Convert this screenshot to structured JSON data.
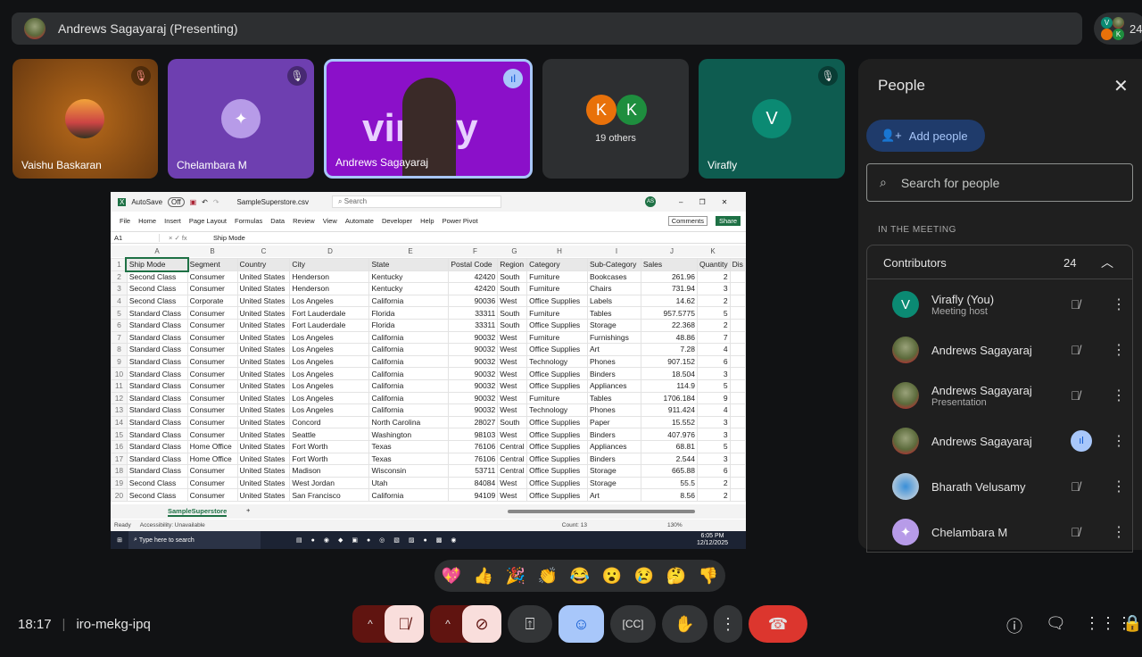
{
  "header": {
    "presenter": "Andrews Sagayaraj (Presenting)",
    "participant_count": "24",
    "mini_avatars": [
      "V",
      "K"
    ]
  },
  "tiles": [
    {
      "name": "Vaishu Baskaran",
      "color": "#8a4a10"
    },
    {
      "name": "Chelambara M",
      "color": "#6e3fb0"
    },
    {
      "name": "Andrews Sagayaraj",
      "color": "#8b10c9",
      "bg_text": "virafly"
    },
    {
      "name": "19 others",
      "avatars": [
        "K",
        "K"
      ],
      "color": "#2d2f31"
    },
    {
      "name": "Virafly",
      "initial": "V",
      "color": "#0e5c50"
    }
  ],
  "excel": {
    "autosave": "AutoSave",
    "autosave_state": "Off",
    "filename": "SampleSuperstore.csv",
    "search": "Search",
    "user": "AS",
    "menu": [
      "File",
      "Home",
      "Insert",
      "Page Layout",
      "Formulas",
      "Data",
      "Review",
      "View",
      "Automate",
      "Developer",
      "Help",
      "Power Pivot"
    ],
    "comments": "Comments",
    "share": "Share",
    "cell_ref": "A1",
    "formula": "Ship Mode",
    "col_letters": [
      "A",
      "B",
      "C",
      "D",
      "E",
      "F",
      "G",
      "H",
      "I",
      "J",
      "K",
      ""
    ],
    "headers": [
      "Ship Mode",
      "Segment",
      "Country",
      "City",
      "State",
      "Postal Code",
      "Region",
      "Category",
      "Sub-Category",
      "Sales",
      "Quantity",
      "Dis"
    ],
    "rows": [
      [
        "Second Class",
        "Consumer",
        "United States",
        "Henderson",
        "Kentucky",
        "42420",
        "South",
        "Furniture",
        "Bookcases",
        "261.96",
        "2"
      ],
      [
        "Second Class",
        "Consumer",
        "United States",
        "Henderson",
        "Kentucky",
        "42420",
        "South",
        "Furniture",
        "Chairs",
        "731.94",
        "3"
      ],
      [
        "Second Class",
        "Corporate",
        "United States",
        "Los Angeles",
        "California",
        "90036",
        "West",
        "Office Supplies",
        "Labels",
        "14.62",
        "2"
      ],
      [
        "Standard Class",
        "Consumer",
        "United States",
        "Fort Lauderdale",
        "Florida",
        "33311",
        "South",
        "Furniture",
        "Tables",
        "957.5775",
        "5"
      ],
      [
        "Standard Class",
        "Consumer",
        "United States",
        "Fort Lauderdale",
        "Florida",
        "33311",
        "South",
        "Office Supplies",
        "Storage",
        "22.368",
        "2"
      ],
      [
        "Standard Class",
        "Consumer",
        "United States",
        "Los Angeles",
        "California",
        "90032",
        "West",
        "Furniture",
        "Furnishings",
        "48.86",
        "7"
      ],
      [
        "Standard Class",
        "Consumer",
        "United States",
        "Los Angeles",
        "California",
        "90032",
        "West",
        "Office Supplies",
        "Art",
        "7.28",
        "4"
      ],
      [
        "Standard Class",
        "Consumer",
        "United States",
        "Los Angeles",
        "California",
        "90032",
        "West",
        "Technology",
        "Phones",
        "907.152",
        "6"
      ],
      [
        "Standard Class",
        "Consumer",
        "United States",
        "Los Angeles",
        "California",
        "90032",
        "West",
        "Office Supplies",
        "Binders",
        "18.504",
        "3"
      ],
      [
        "Standard Class",
        "Consumer",
        "United States",
        "Los Angeles",
        "California",
        "90032",
        "West",
        "Office Supplies",
        "Appliances",
        "114.9",
        "5"
      ],
      [
        "Standard Class",
        "Consumer",
        "United States",
        "Los Angeles",
        "California",
        "90032",
        "West",
        "Furniture",
        "Tables",
        "1706.184",
        "9"
      ],
      [
        "Standard Class",
        "Consumer",
        "United States",
        "Los Angeles",
        "California",
        "90032",
        "West",
        "Technology",
        "Phones",
        "911.424",
        "4"
      ],
      [
        "Standard Class",
        "Consumer",
        "United States",
        "Concord",
        "North Carolina",
        "28027",
        "South",
        "Office Supplies",
        "Paper",
        "15.552",
        "3"
      ],
      [
        "Standard Class",
        "Consumer",
        "United States",
        "Seattle",
        "Washington",
        "98103",
        "West",
        "Office Supplies",
        "Binders",
        "407.976",
        "3"
      ],
      [
        "Standard Class",
        "Home Office",
        "United States",
        "Fort Worth",
        "Texas",
        "76106",
        "Central",
        "Office Supplies",
        "Appliances",
        "68.81",
        "5"
      ],
      [
        "Standard Class",
        "Home Office",
        "United States",
        "Fort Worth",
        "Texas",
        "76106",
        "Central",
        "Office Supplies",
        "Binders",
        "2.544",
        "3"
      ],
      [
        "Standard Class",
        "Consumer",
        "United States",
        "Madison",
        "Wisconsin",
        "53711",
        "Central",
        "Office Supplies",
        "Storage",
        "665.88",
        "6"
      ],
      [
        "Second Class",
        "Consumer",
        "United States",
        "West Jordan",
        "Utah",
        "84084",
        "West",
        "Office Supplies",
        "Storage",
        "55.5",
        "2"
      ],
      [
        "Second Class",
        "Consumer",
        "United States",
        "San Francisco",
        "California",
        "94109",
        "West",
        "Office Supplies",
        "Art",
        "8.56",
        "2"
      ]
    ],
    "sheet_tab": "SampleSuperstore",
    "status_ready": "Ready",
    "accessibility": "Accessibility: Unavailable",
    "count": "Count: 13",
    "zoom": "130%",
    "taskbar_search": "Type here to search",
    "time": "6:05 PM",
    "date": "12/12/2025"
  },
  "people": {
    "title": "People",
    "add_people": "Add people",
    "search_placeholder": "Search for people",
    "section": "IN THE MEETING",
    "group": "Contributors",
    "group_count": "24",
    "members": [
      {
        "name": "Virafly (You)",
        "sub": "Meeting host",
        "initial": "V",
        "mic": "muted"
      },
      {
        "name": "Andrews Sagayaraj",
        "sub": "",
        "mic": "muted"
      },
      {
        "name": "Andrews Sagayaraj",
        "sub": "Presentation",
        "mic": "muted"
      },
      {
        "name": "Andrews Sagayaraj",
        "sub": "",
        "mic": "speaking"
      },
      {
        "name": "Bharath Velusamy",
        "sub": "",
        "mic": "muted"
      },
      {
        "name": "Chelambara M",
        "sub": "",
        "mic": "muted"
      }
    ]
  },
  "reactions": [
    "💖",
    "👍",
    "🎉",
    "👏",
    "😂",
    "😮",
    "😢",
    "🤔",
    "👎"
  ],
  "footer": {
    "time": "18:17",
    "meeting_code": "iro-mekg-ipq"
  },
  "colors": {
    "accent": "#a8c7fa",
    "end_call": "#dc362e",
    "muted_bg": "#f9dedc",
    "muted_dark": "#601410",
    "excel_green": "#1e7145"
  }
}
